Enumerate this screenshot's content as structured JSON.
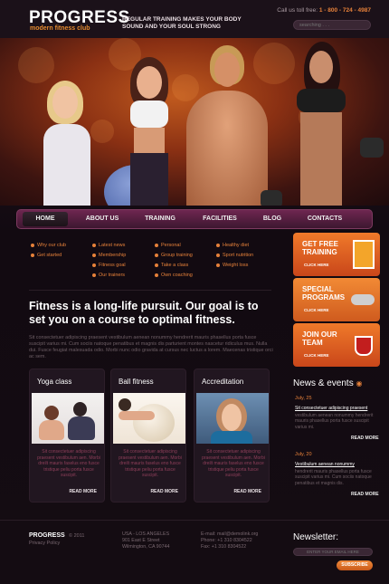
{
  "header": {
    "logo": "PROGRESS",
    "logo_sub": "modern fitness club",
    "tagline": "REGULAR TRAINING MAKES YOUR BODY SOUND AND YOUR SOUL STRONG",
    "phone_label": "Call us toll free:",
    "phone_number": "1 - 800 - 724 - 4987",
    "search_placeholder": "searching . . ."
  },
  "nav": [
    "HOME",
    "ABOUT US",
    "TRAINING",
    "FACILITIES",
    "BLOG",
    "CONTACTS"
  ],
  "links": {
    "col1": [
      "Why our club",
      "Get started"
    ],
    "col2": [
      "Latest news",
      "Membership",
      "Fitness goal",
      "Our trainers"
    ],
    "col3": [
      "Personal",
      "Group training",
      "Take a class",
      "Own coaching"
    ],
    "col4": [
      "Healthy diet",
      "Sport nutrition",
      "Weight loss"
    ]
  },
  "headline": "Fitness is a long-life pursuit. Our goal is to set you on a course to optimal fitness.",
  "intro": "Sit consectetuer adipiscing praesent vestibulum aenean nonummy hendrerit mauris phasellus porta fusce suscipit varius mi. Cum sociis natoque penatibus et magnis dis parturient montes nascetur ridiculus mus. Nulla dui. Fusce feugiat malesuada odio. Morbi nunc odio gravida at cursus nec luctus a lorem. Maecenas tristique orci ac sem.",
  "cards": [
    {
      "title": "Yoga class",
      "text": "Sit consectetuer adipiscing praesent vestibulum aen. Morbi dreilt mauris faselus eno fusce tristique peliu porta fusce suscipit.",
      "more": "READ MORE"
    },
    {
      "title": "Ball fitness",
      "text": "Sit consectetuer adipiscing praesent vestibulum aen. Morbi dreilt mauris faselus eno fusce tristique peliu porta fusce suscipit.",
      "more": "READ MORE"
    },
    {
      "title": "Accreditation",
      "text": "Sit consectetuer adipiscing praesent vestibulum aen. Morbi dreilt mauris faselus eno fusce tristique peliu porta fusce suscipit.",
      "more": "READ MORE"
    }
  ],
  "promos": [
    {
      "title": "GET FREE TRAINING",
      "click": "CLICK HERE",
      "color": "#e8671f"
    },
    {
      "title": "SPECIAL PROGRAMS",
      "click": "CLICK HERE",
      "color": "#e8771f"
    },
    {
      "title": "JOIN OUR TEAM",
      "click": "CLICK HERE",
      "color": "#e86a1f"
    }
  ],
  "news": {
    "title": "News & events",
    "items": [
      {
        "date": "July, 25",
        "head": "Sit consectetuer adipiscing praesent",
        "body": "vestibulum aenean nonummy hendrerit mauris phasellus porta fusce suscipit varius mi.",
        "more": "READ MORE"
      },
      {
        "date": "July, 20",
        "head": "Vestibulum aenean nonummy",
        "body": "hendrerit mauris phasellus porta fusce suscipit varius mi. Cum sociis natoque penatibus et magnis dis.",
        "more": "READ MORE"
      }
    ]
  },
  "footer": {
    "logo": "PROGRESS",
    "year": "© 2011",
    "privacy": "Privacy Policy",
    "address": [
      "USA - LOS ANGELES",
      "901 East E Street",
      "Wilmington, CA 90744"
    ],
    "contact": [
      "E-mail: mail@demolink.org",
      "Phone: +1 310 8304522",
      "Fax: +1 310 8304522"
    ],
    "newsletter_title": "Newsletter:",
    "newsletter_placeholder": "ENTER YOUR EMAIL HERE",
    "subscribe": "SUBSCRIBE"
  },
  "colors": {
    "accent": "#e6813a",
    "nav": "#6e2650",
    "background": "#140c13"
  }
}
